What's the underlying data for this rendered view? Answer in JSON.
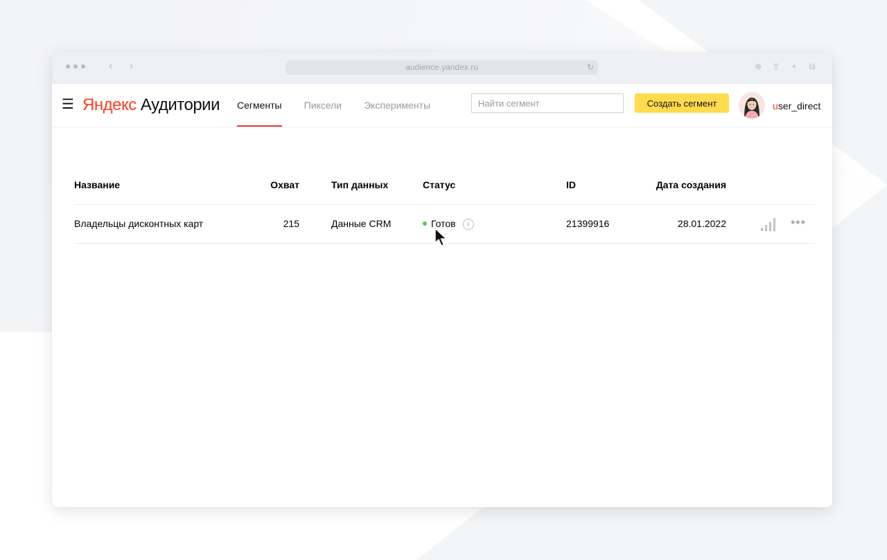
{
  "browser": {
    "url": "audience.yandex.ru"
  },
  "header": {
    "logo_brand": "Яндекс",
    "logo_product": "Аудитории",
    "tabs": [
      {
        "label": "Сегменты",
        "active": true
      },
      {
        "label": "Пиксели",
        "active": false
      },
      {
        "label": "Эксперименты",
        "active": false
      }
    ],
    "search_placeholder": "Найти сегмент",
    "create_button": "Создать сегмент",
    "username_first": "u",
    "username_rest": "ser_direct"
  },
  "table": {
    "columns": {
      "name": "Название",
      "reach": "Охват",
      "data_type": "Тип данных",
      "status": "Статус",
      "id": "ID",
      "created": "Дата создания"
    },
    "rows": [
      {
        "name": "Владельцы дисконтных карт",
        "reach": "215",
        "data_type": "Данные CRM",
        "status": "Готов",
        "id": "21399916",
        "created": "28.01.2022"
      }
    ]
  },
  "colors": {
    "accent_yellow": "#ffdb4d",
    "brand_red": "#fc3f1d",
    "active_tab_underline": "#e53935",
    "status_ready": "#5cc25c"
  },
  "icons": {
    "menu": "hamburger-icon",
    "info": "info-icon",
    "stats": "bar-chart-icon",
    "more": "more-dots-icon"
  }
}
